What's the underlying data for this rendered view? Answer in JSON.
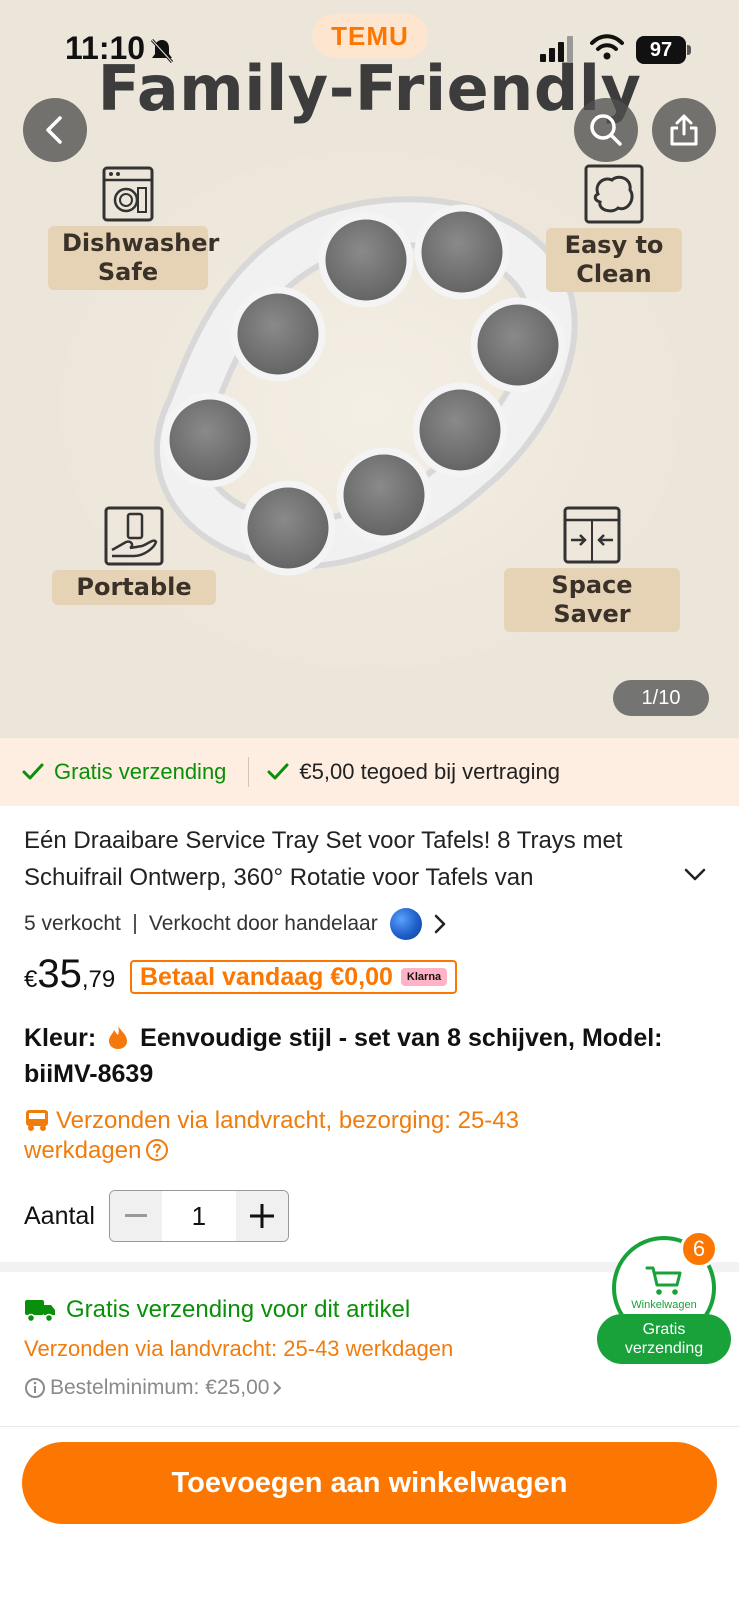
{
  "status_bar": {
    "time": "11:10",
    "battery": "97",
    "app_logo": "TEMU"
  },
  "hero": {
    "headline": "Family-Friendly",
    "features": {
      "dishwasher": "Dishwasher Safe",
      "easy_clean": "Easy to Clean",
      "portable": "Portable",
      "space_saver": "Space Saver"
    },
    "pager": "1/10"
  },
  "guarantee": {
    "free_shipping": "Gratis verzending",
    "credit": "€5,00 tegoed bij vertraging"
  },
  "product": {
    "title": "Eén Draaibare Service Tray Set voor Tafels! 8 Trays met Schuifrail Ontwerp, 360° Rotatie voor Tafels van",
    "sold": "5 verkocht",
    "seller": "Verkocht door handelaar",
    "price_currency": "€",
    "price_main": "35",
    "price_decimal": ",79",
    "pay_today": "Betaal vandaag €0,00",
    "klarna": "Klarna",
    "variant_label": "Kleur:",
    "variant_value": "Eenvoudige stijl - set van 8 schijven, Model: biiMV-8639",
    "shipping_line": "Verzonden via landvracht, bezorging: 25-43 werkdagen",
    "quantity_label": "Aantal",
    "quantity_value": "1"
  },
  "shipping_box": {
    "free": "Gratis verzending voor dit artikel",
    "days": "Verzonden via landvracht: 25-43 werkdagen",
    "minimum": "Bestelminimum: €25,00"
  },
  "cart": {
    "badge": "6",
    "label": "Winkelwagen",
    "free": "Gratis verzending"
  },
  "cta": {
    "add_to_cart": "Toevoegen aan winkelwagen"
  },
  "colors": {
    "accent": "#fb7701",
    "green": "#0a8f08",
    "cart_green": "#19a23a"
  }
}
